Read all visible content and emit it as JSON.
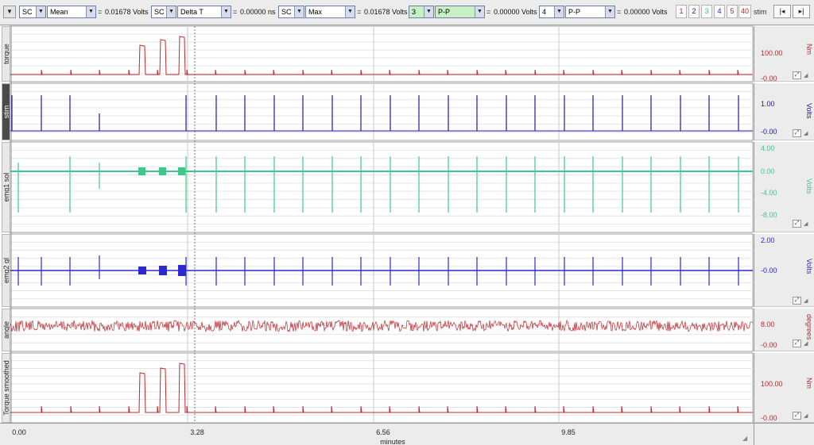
{
  "toolbar": {
    "menu_arrow": "▼",
    "measurements": [
      {
        "channel": "SC",
        "type": "Mean",
        "value": "0.01678 Volts",
        "color": "#000000"
      },
      {
        "channel": "SC",
        "type": "Delta T",
        "value": "0.00000 ns",
        "color": "#000000"
      },
      {
        "channel": "SC",
        "type": "Max",
        "value": "0.01678 Volts",
        "color": "#000000"
      },
      {
        "channel": "3",
        "type": "P-P",
        "value": "0.00000 Volts",
        "color": "#1e8a3c"
      },
      {
        "channel": "4",
        "type": "P-P",
        "value": "0.00000 Volts",
        "color": "#000000"
      }
    ],
    "equals": "=",
    "channel_buttons": [
      {
        "label": "1",
        "color": "#c0272d"
      },
      {
        "label": "2",
        "color": "#1a1aa0"
      },
      {
        "label": "3",
        "color": "#3cc88c"
      },
      {
        "label": "4",
        "color": "#2a2acf"
      },
      {
        "label": "5",
        "color": "#c0272d"
      },
      {
        "label": "40",
        "color": "#c0272d"
      }
    ],
    "active_channel": "stim",
    "scroll_left": "|◂",
    "scroll_right": "▸|"
  },
  "channels": [
    {
      "name": "torque",
      "color": "#c0272d",
      "unit": "Nm",
      "ticks": [
        "100.00",
        "-0.00"
      ],
      "active": false
    },
    {
      "name": "stim",
      "color": "#1a1aa0",
      "unit": "Volts",
      "ticks": [
        "1.00",
        "-0.00"
      ],
      "active": true
    },
    {
      "name": "emg1 sol",
      "color": "#3cc88c",
      "unit": "Volts",
      "ticks": [
        "4.00",
        "0.00",
        "-4.00",
        "-8.00"
      ],
      "active": false
    },
    {
      "name": "emg2 gl",
      "color": "#2a2acf",
      "unit": "Volts",
      "ticks": [
        "2.00",
        "-0.00"
      ],
      "active": false
    },
    {
      "name": "angle",
      "color": "#c0272d",
      "unit": "degrees",
      "ticks": [
        "8.00",
        "-0.00"
      ],
      "active": false
    },
    {
      "name": "Torque smoothed",
      "color": "#c0272d",
      "unit": "Nm",
      "ticks": [
        "100.00",
        "-0.00"
      ],
      "active": false
    }
  ],
  "time_axis": {
    "ticks": [
      "0.00",
      "3.28",
      "6.56",
      "9.85"
    ],
    "unit": "minutes"
  },
  "scale_icon": "⤢",
  "scale_icon_small": "◢"
}
